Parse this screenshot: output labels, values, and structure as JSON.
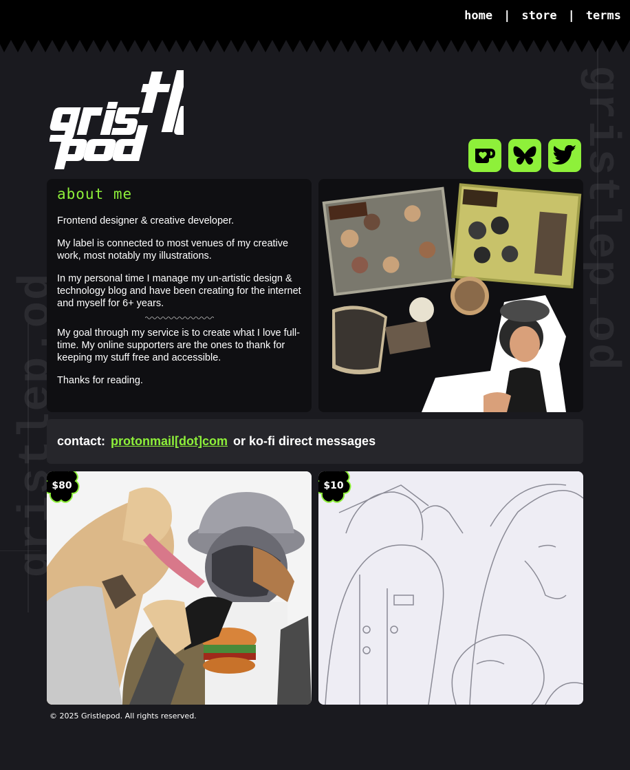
{
  "nav": {
    "home": "home",
    "store": "store",
    "terms": "terms",
    "separator": "|"
  },
  "brand": {
    "logo_icon": "gristlepod-logo",
    "watermark": "gristlep.od"
  },
  "social": [
    {
      "icon": "kofi-icon"
    },
    {
      "icon": "bluesky-icon"
    },
    {
      "icon": "twitter-icon"
    }
  ],
  "about": {
    "title": "about me",
    "p1": "Frontend designer & creative developer.",
    "p2": "My label is connected to most venues of my creative work, most notably my illustrations.",
    "p3": "In my personal time I manage my un-artistic design & technology blog and have been creating for the internet and myself for 6+ years.",
    "p4": "My goal through my service is to create what I love full-time. My online supporters are the ones to thank for keeping my stuff free and accessible.",
    "p5": "Thanks for reading."
  },
  "contact": {
    "label": "contact:",
    "email": "protonmail[dot]com",
    "suffix": "or ko-fi direct messages"
  },
  "commissions": [
    {
      "price": "$80"
    },
    {
      "price": "$10"
    }
  ],
  "footer": {
    "copyright": "© 2025 Gristlepod. All rights reserved."
  },
  "colors": {
    "accent": "#8ef03a",
    "background": "#1a1a1f",
    "card": "#0f0f12",
    "contact_bg": "#26262b"
  }
}
